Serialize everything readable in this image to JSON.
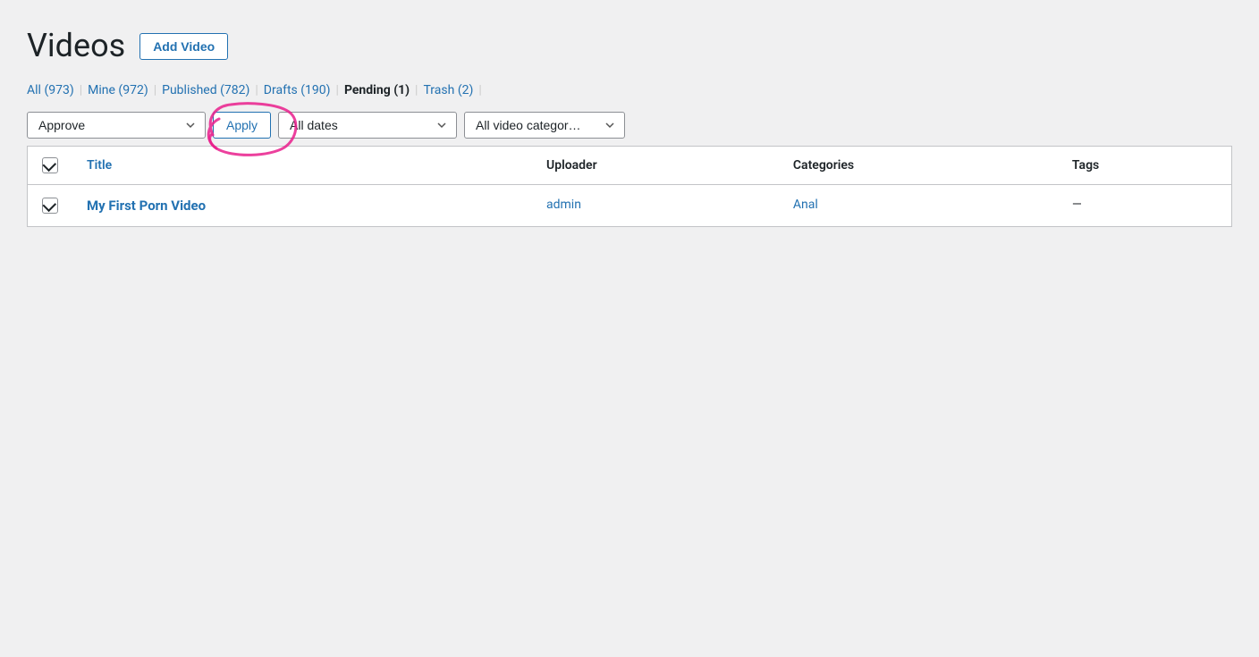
{
  "page": {
    "title": "Videos",
    "add_button_label": "Add Video"
  },
  "filter_links": [
    {
      "id": "all",
      "label": "All",
      "count": "(973)",
      "active": false
    },
    {
      "id": "mine",
      "label": "Mine",
      "count": "(972)",
      "active": false
    },
    {
      "id": "published",
      "label": "Published",
      "count": "(782)",
      "active": false
    },
    {
      "id": "drafts",
      "label": "Drafts",
      "count": "(190)",
      "active": false
    },
    {
      "id": "pending",
      "label": "Pending",
      "count": "(1)",
      "active": true
    },
    {
      "id": "trash",
      "label": "Trash",
      "count": "(2)",
      "active": false
    }
  ],
  "toolbar": {
    "bulk_action_label": "Approve",
    "apply_label": "Apply",
    "dates_placeholder": "All dates",
    "categories_placeholder": "All video categor…"
  },
  "table": {
    "columns": {
      "title": "Title",
      "uploader": "Uploader",
      "categories": "Categories",
      "tags": "Tags"
    },
    "rows": [
      {
        "id": 1,
        "title": "My First Porn Video",
        "uploader": "admin",
        "categories": "Anal",
        "tags": "—"
      }
    ]
  }
}
